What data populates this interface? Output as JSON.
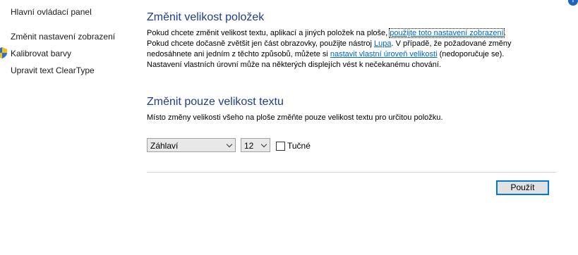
{
  "sidebar": {
    "home": "Hlavní ovládací panel",
    "items": [
      {
        "label": "Změnit nastavení zobrazení"
      },
      {
        "label": "Kalibrovat barvy"
      },
      {
        "label": "Upravit text ClearType"
      }
    ]
  },
  "section1": {
    "title": "Změnit velikost položek",
    "line1_prefix": "Pokud chcete změnit velikost textu, aplikací a jiných položek na ploše, ",
    "line1_link": "použijte toto nastavení zobrazení",
    "line1_suffix": ".",
    "line2_prefix": "Pokud chcete dočasně zvětšit jen část obrazovky, použijte nástroj ",
    "line2_link": "Lupa",
    "line2_suffix": ". V případě, že požadované změny",
    "line3_prefix": "nedosáhnete ani jedním z těchto způsobů, můžete si ",
    "line3_link": "nastavit vlastní úroveň velikosti",
    "line3_suffix": " (nedoporučuje se).",
    "line4": "Nastavení vlastních úrovní může na některých displejích vést k nečekanému chování."
  },
  "section2": {
    "title": "Změnit pouze velikost textu",
    "description": "Místo změny velikosti všeho na ploše změňte pouze velikost textu pro určitou položku.",
    "item_select": "Záhlaví",
    "size_select": "12",
    "bold_label": "Tučné"
  },
  "apply_label": "Použít",
  "help_icon": "?"
}
